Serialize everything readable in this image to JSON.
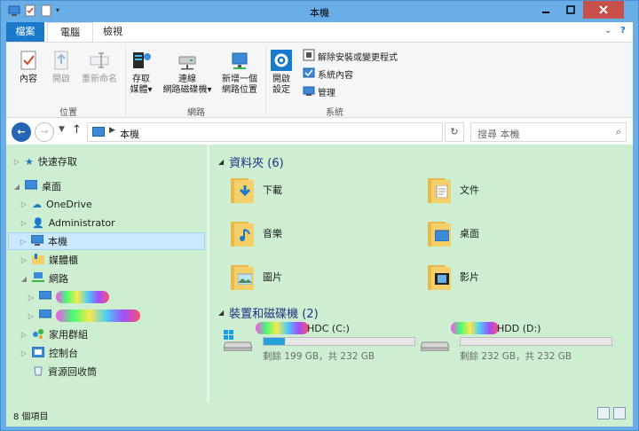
{
  "window": {
    "title": "本機"
  },
  "tabs": [
    {
      "label": "檔案"
    },
    {
      "label": "電腦"
    },
    {
      "label": "檢視"
    }
  ],
  "ribbon": {
    "location": {
      "label": "位置",
      "buttons": [
        {
          "label": "內容"
        },
        {
          "label": "開啟"
        },
        {
          "label": "重新命名"
        }
      ]
    },
    "network": {
      "label": "網路",
      "buttons": [
        {
          "line1": "存取",
          "line2": "媒體"
        },
        {
          "line1": "連線",
          "line2": "網路磁碟機"
        },
        {
          "line1": "新增一個",
          "line2": "網路位置"
        }
      ]
    },
    "system": {
      "label": "系統",
      "open": {
        "line1": "開啟",
        "line2": "設定"
      },
      "items": [
        {
          "label": "解除安裝或變更程式"
        },
        {
          "label": "系統內容"
        },
        {
          "label": "管理"
        }
      ]
    }
  },
  "address": {
    "path": "本機",
    "search_placeholder": "搜尋 本機"
  },
  "nav": {
    "quick_access": "快速存取",
    "desktop": "桌面",
    "onedrive": "OneDrive",
    "admin": "Administrator",
    "this_pc": "本機",
    "libraries": "媒體櫃",
    "network": "網路",
    "homegroup": "家用群組",
    "control_panel": "控制台",
    "recycle_bin": "資源回收筒"
  },
  "folders_section": {
    "title": "資料夾 (6)",
    "items": [
      {
        "name": "下載"
      },
      {
        "name": "文件"
      },
      {
        "name": "音樂"
      },
      {
        "name": "桌面"
      },
      {
        "name": "圖片"
      },
      {
        "name": "影片"
      }
    ]
  },
  "drives_section": {
    "title": "裝置和磁碟機 (2)",
    "drives": [
      {
        "name": "HDC (C:)",
        "info": "剩餘 199 GB，共 232 GB",
        "used_fraction": 0.14
      },
      {
        "name": "HDD (D:)",
        "info": "剩餘 232 GB，共 232 GB",
        "used_fraction": 0.0
      }
    ]
  },
  "status": {
    "items": "8 個項目"
  }
}
